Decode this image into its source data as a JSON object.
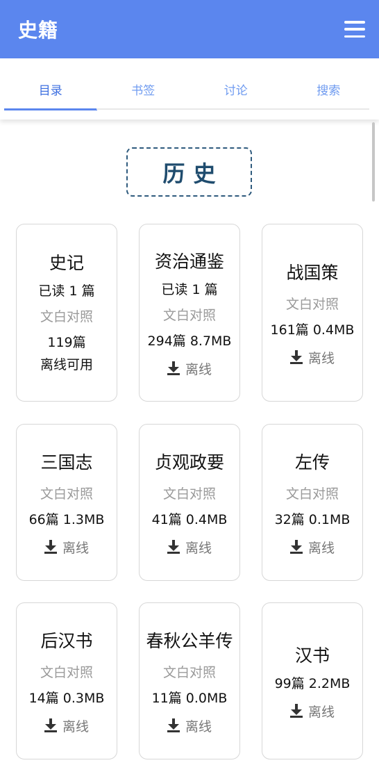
{
  "appbar": {
    "title": "史籍",
    "menu_icon": "hamburger-menu-icon"
  },
  "tabs": [
    {
      "label": "目录",
      "active": true
    },
    {
      "label": "书签",
      "active": false
    },
    {
      "label": "讨论",
      "active": false
    },
    {
      "label": "搜索",
      "active": false
    }
  ],
  "section": {
    "title": "历史"
  },
  "books": [
    {
      "title": "史记",
      "read": "已读 1 篇",
      "tag": "文白对照",
      "size": "119篇",
      "status": "离线可用"
    },
    {
      "title": "资治通鉴",
      "read": "已读 1 篇",
      "tag": "文白对照",
      "size": "294篇 8.7MB",
      "offline": "离线"
    },
    {
      "title": "战国策",
      "tag": "文白对照",
      "size": "161篇 0.4MB",
      "offline": "离线"
    },
    {
      "title": "三国志",
      "tag": "文白对照",
      "size": "66篇 1.3MB",
      "offline": "离线"
    },
    {
      "title": "贞观政要",
      "tag": "文白对照",
      "size": "41篇 0.4MB",
      "offline": "离线"
    },
    {
      "title": "左传",
      "tag": "文白对照",
      "size": "32篇 0.1MB",
      "offline": "离线"
    },
    {
      "title": "后汉书",
      "tag": "文白对照",
      "size": "14篇 0.3MB",
      "offline": "离线"
    },
    {
      "title": "春秋公羊传",
      "tag": "文白对照",
      "size": "11篇 0.0MB",
      "offline": "离线"
    },
    {
      "title": "汉书",
      "size": "99篇 2.2MB",
      "offline": "离线"
    }
  ],
  "colors": {
    "accent": "#5b86ee",
    "section_border": "#2e5a7d"
  }
}
